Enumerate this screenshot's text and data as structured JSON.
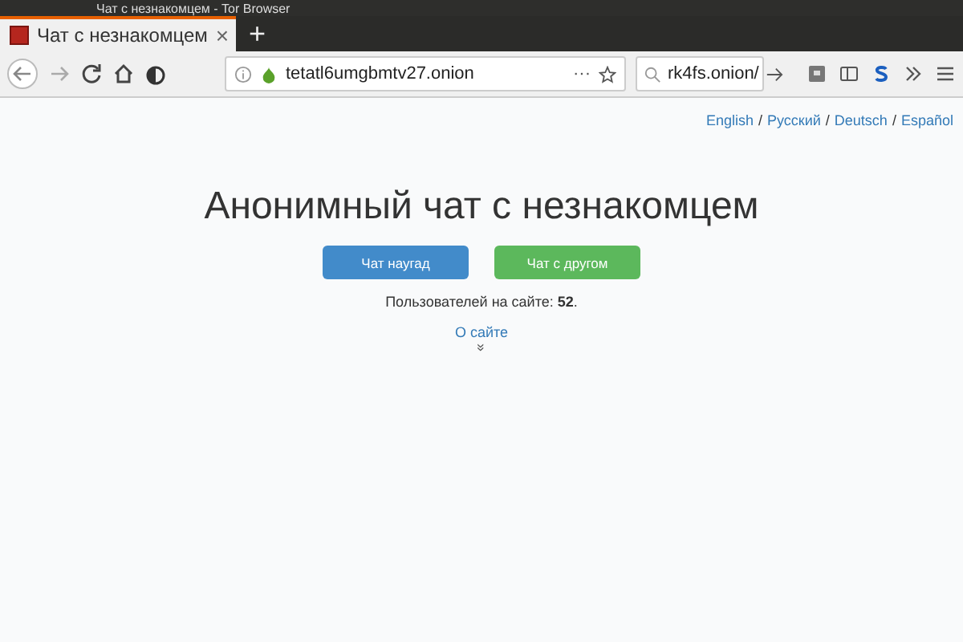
{
  "window": {
    "title": "Чат с незнакомцем - Tor Browser"
  },
  "tabs": [
    {
      "label": "Чат с незнакомцем",
      "selected": true,
      "close": "×"
    }
  ],
  "new_tab": "+",
  "address_bar": {
    "value": "tetatl6umgbmtv27.onion",
    "more": "···"
  },
  "search": {
    "value": "rk4fs.onion/"
  },
  "page": {
    "language_separator": "/",
    "languages": [
      {
        "label": "English"
      },
      {
        "label": "Русский"
      },
      {
        "label": "Deutsch"
      },
      {
        "label": "Español"
      }
    ],
    "heading": "Анонимный чат с незнакомцем",
    "buttons": [
      {
        "label": "Чат наугад",
        "kind": "primary"
      },
      {
        "label": "Чат с другом",
        "kind": "success"
      }
    ],
    "users_online": "Пользователей на сайте: **52**.",
    "about_link": "О сайте",
    "about_arrow": "»"
  }
}
